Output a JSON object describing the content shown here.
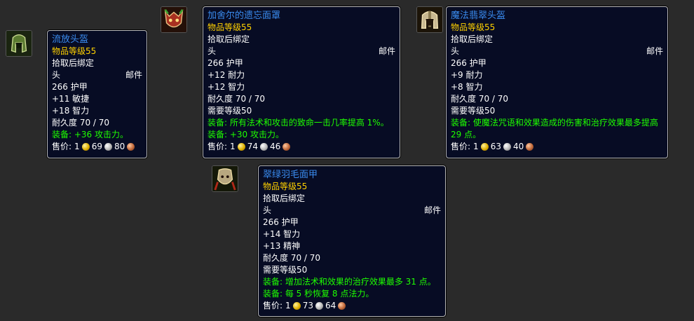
{
  "items": [
    {
      "name": "流放头盔",
      "ilvl": "物品等级55",
      "bind": "拾取后绑定",
      "slot": "头",
      "type": "邮件",
      "armor": "266 护甲",
      "stats": [
        "+11 敏捷",
        "+18 智力"
      ],
      "durability": "耐久度 70 / 70",
      "req": "",
      "equips": [
        "装备: +36 攻击力。"
      ],
      "sell_label": "售价:",
      "gold": "1",
      "silver": "69",
      "copper": "80"
    },
    {
      "name": "加舍尔的遗忘面罩",
      "ilvl": "物品等级55",
      "bind": "拾取后绑定",
      "slot": "头",
      "type": "邮件",
      "armor": "266 护甲",
      "stats": [
        "+12 耐力",
        "+12 智力"
      ],
      "durability": "耐久度 70 / 70",
      "req": "需要等级50",
      "equips": [
        "装备: 所有法术和攻击的致命一击几率提高 1%。",
        "装备: +30 攻击力。"
      ],
      "sell_label": "售价:",
      "gold": "1",
      "silver": "74",
      "copper": "46"
    },
    {
      "name": "魔法翡翠头盔",
      "ilvl": "物品等级55",
      "bind": "拾取后绑定",
      "slot": "头",
      "type": "邮件",
      "armor": "266 护甲",
      "stats": [
        "+9 耐力",
        "+8 智力"
      ],
      "durability": "耐久度 70 / 70",
      "req": "需要等级50",
      "equips": [
        "装备: 使魔法咒语和效果造成的伤害和治疗效果最多提高 29 点。"
      ],
      "sell_label": "售价:",
      "gold": "1",
      "silver": "63",
      "copper": "40"
    },
    {
      "name": "翠绿羽毛面甲",
      "ilvl": "物品等级55",
      "bind": "拾取后绑定",
      "slot": "头",
      "type": "邮件",
      "armor": "266 护甲",
      "stats": [
        "+14 智力",
        "+13 精神"
      ],
      "durability": "耐久度 70 / 70",
      "req": "需要等级50",
      "equips": [
        "装备: 增加法术和效果的治疗效果最多 31 点。",
        "装备: 每 5 秒恢复 8 点法力。"
      ],
      "sell_label": "售价:",
      "gold": "1",
      "silver": "73",
      "copper": "64"
    }
  ],
  "colors": {
    "name": "#3a8cf0",
    "ilvl": "#ffd100",
    "equip": "#1eff00",
    "tooltip_bg": "#070c24"
  },
  "icons": [
    "helm-exile-icon",
    "mask-gahzerilla-icon",
    "helm-emerald-icon",
    "faceguard-feather-icon"
  ]
}
